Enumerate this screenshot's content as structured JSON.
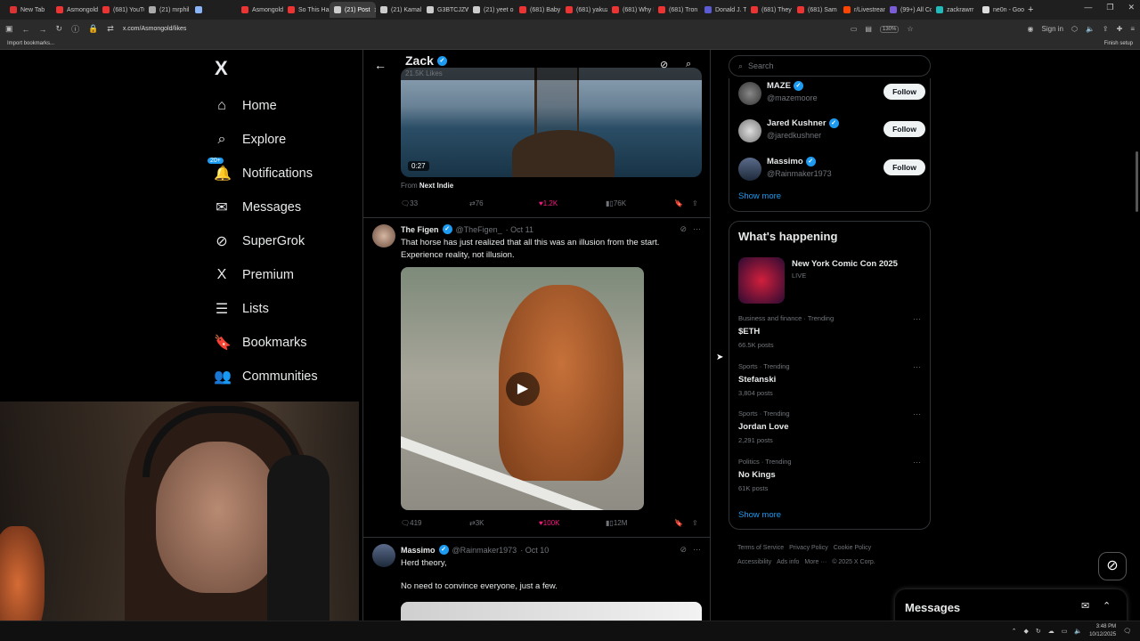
{
  "browser": {
    "tabs": [
      {
        "title": "New Tab",
        "color": "#d33"
      },
      {
        "title": "Asmongold",
        "color": "#e33"
      },
      {
        "title": "(681) YouTu",
        "color": "#e33"
      },
      {
        "title": "(21) mrphil",
        "color": "#aaa"
      },
      {
        "title": "",
        "color": "#8ab4f8"
      },
      {
        "title": "Asmongold",
        "color": "#e33"
      },
      {
        "title": "So This Hap",
        "color": "#e33"
      },
      {
        "title": "(21) Post",
        "color": "#ccc",
        "active": true
      },
      {
        "title": "(21) Kamal",
        "color": "#ccc"
      },
      {
        "title": "G3BTCJZW",
        "color": "#ccc"
      },
      {
        "title": "(21) yeet o",
        "color": "#ccc"
      },
      {
        "title": "(681) Baby",
        "color": "#e33"
      },
      {
        "title": "(681) yakuz",
        "color": "#e33"
      },
      {
        "title": "(681) Why I",
        "color": "#e33"
      },
      {
        "title": "(681) Tron",
        "color": "#e33"
      },
      {
        "title": "Donald J. Tr",
        "color": "#5b5bd6"
      },
      {
        "title": "(681) They",
        "color": "#e33"
      },
      {
        "title": "(681) Sam",
        "color": "#e33"
      },
      {
        "title": "r/Livestrean",
        "color": "#ff4500"
      },
      {
        "title": "(99+) All Co",
        "color": "#7a5cd6"
      },
      {
        "title": "zackrawrr",
        "color": "#2bb"
      },
      {
        "title": "ne0n - Goo",
        "color": "#ddd"
      }
    ],
    "url": "x.com/Asmongold/likes",
    "zoom": "130%",
    "sign_in": "Sign in",
    "bookmark_import": "Import bookmarks...",
    "finish_setup": "Finish setup"
  },
  "nav": {
    "logo": "X",
    "notif_badge": "20+",
    "items": [
      {
        "label": "Home",
        "icon": "⌂"
      },
      {
        "label": "Explore",
        "icon": "⌕"
      },
      {
        "label": "Notifications",
        "icon": "🔔"
      },
      {
        "label": "Messages",
        "icon": "✉"
      },
      {
        "label": "SuperGrok",
        "icon": "⊘"
      },
      {
        "label": "Premium",
        "icon": "X"
      },
      {
        "label": "Lists",
        "icon": "☰"
      },
      {
        "label": "Bookmarks",
        "icon": "🔖"
      },
      {
        "label": "Communities",
        "icon": "👥"
      }
    ]
  },
  "profile_header": {
    "name": "Zack",
    "likes": "21.5K Likes"
  },
  "post1": {
    "duration": "0:27",
    "from_prefix": "From",
    "from_source": "Next Indie",
    "replies": "33",
    "reposts": "76",
    "likes": "1.2K",
    "views": "76K"
  },
  "post2": {
    "name": "The Figen",
    "handle": "@TheFigen_",
    "date": "· Oct 11",
    "text": "That horse has just realized that all this was an illusion from the start. Experience reality, not illusion.",
    "replies": "419",
    "reposts": "3K",
    "likes": "100K",
    "views": "12M"
  },
  "post3": {
    "name": "Massimo",
    "handle": "@Rainmaker1973",
    "date": "· Oct 10",
    "text1": "Herd theory,",
    "text2": "No need to convince everyone, just a few."
  },
  "sidebar": {
    "search_placeholder": "Search",
    "who_to_follow": [
      {
        "name": "MAZE",
        "handle": "@mazemoore",
        "button": "Follow"
      },
      {
        "name": "Jared Kushner",
        "handle": "@jaredkushner",
        "button": "Follow"
      },
      {
        "name": "Massimo",
        "handle": "@Rainmaker1973",
        "button": "Follow"
      }
    ],
    "show_more": "Show more",
    "happening_title": "What's happening",
    "event": {
      "title": "New York Comic Con 2025",
      "status": "LIVE"
    },
    "trends": [
      {
        "category": "Business and finance · Trending",
        "title": "$ETH",
        "count": "66.5K posts"
      },
      {
        "category": "Sports · Trending",
        "title": "Stefanski",
        "count": "3,804 posts"
      },
      {
        "category": "Sports · Trending",
        "title": "Jordan Love",
        "count": "2,291 posts"
      },
      {
        "category": "Politics · Trending",
        "title": "No Kings",
        "count": "61K posts"
      }
    ],
    "show_more_2": "Show more",
    "footer": [
      "Terms of Service",
      "Privacy Policy",
      "Cookie Policy",
      "Accessibility",
      "Ads info",
      "More ···",
      "© 2025 X Corp."
    ]
  },
  "messages_drawer": {
    "title": "Messages"
  },
  "taskbar": {
    "time": "3:48 PM",
    "date": "10/12/2025"
  }
}
